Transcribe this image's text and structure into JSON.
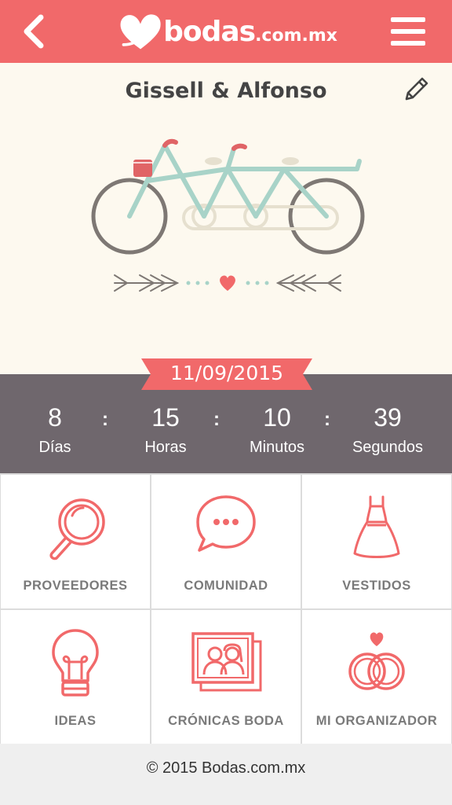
{
  "header": {
    "brand": "bodas",
    "brand_tld": ".com.mx",
    "back_icon": "chevron-left-icon",
    "menu_icon": "hamburger-menu-icon",
    "color": "#f1696a"
  },
  "couple": {
    "names": "Gissell & Alfonso",
    "edit_icon": "pencil-icon"
  },
  "wedding": {
    "date": "11/09/2015"
  },
  "countdown": {
    "separator": ":",
    "units": [
      {
        "value": "8",
        "label": "Días"
      },
      {
        "value": "15",
        "label": "Horas"
      },
      {
        "value": "10",
        "label": "Minutos"
      },
      {
        "value": "39",
        "label": "Segundos"
      }
    ]
  },
  "menu": [
    {
      "label": "PROVEEDORES",
      "icon": "magnifier-icon"
    },
    {
      "label": "COMUNIDAD",
      "icon": "speech-bubble-icon"
    },
    {
      "label": "VESTIDOS",
      "icon": "dress-icon"
    },
    {
      "label": "IDEAS",
      "icon": "lightbulb-icon"
    },
    {
      "label": "CRÓNICAS BODA",
      "icon": "photo-couple-icon"
    },
    {
      "label": "MI ORGANIZADOR",
      "icon": "rings-icon"
    }
  ],
  "footer": {
    "copyright": "© 2015 Bodas.com.mx"
  },
  "colors": {
    "accent": "#f1696a",
    "countdown_bg": "#6f676d",
    "hero_bg": "#fdf9ef"
  }
}
